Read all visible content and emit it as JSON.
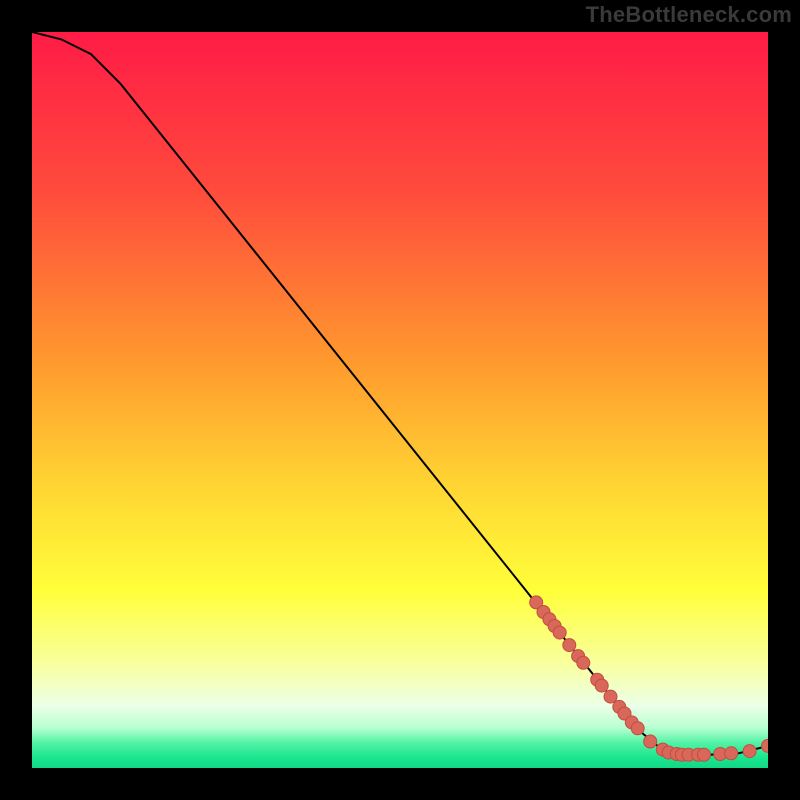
{
  "attribution": "TheBottleneck.com",
  "colors": {
    "frame": "#000000",
    "attribution_text": "#3a3a3a",
    "curve": "#000000",
    "marker_fill": "#d9675a",
    "marker_stroke": "#c24d40",
    "gradient_stops": [
      {
        "offset": 0.0,
        "color": "#ff1b46"
      },
      {
        "offset": 0.22,
        "color": "#ff4c3c"
      },
      {
        "offset": 0.45,
        "color": "#ff9a2e"
      },
      {
        "offset": 0.62,
        "color": "#ffd633"
      },
      {
        "offset": 0.76,
        "color": "#ffff3a"
      },
      {
        "offset": 0.86,
        "color": "#f8ffa0"
      },
      {
        "offset": 0.915,
        "color": "#ecffe8"
      },
      {
        "offset": 0.945,
        "color": "#b8ffd0"
      },
      {
        "offset": 0.965,
        "color": "#55f3a7"
      },
      {
        "offset": 0.985,
        "color": "#1de690"
      },
      {
        "offset": 1.0,
        "color": "#10d884"
      }
    ]
  },
  "chart_data": {
    "type": "line",
    "title": "",
    "xlabel": "",
    "ylabel": "",
    "xlim": [
      0,
      100
    ],
    "ylim": [
      0,
      100
    ],
    "series": [
      {
        "name": "bottleneck-curve",
        "x": [
          0,
          4,
          8,
          12,
          20,
          30,
          40,
          50,
          60,
          68,
          72,
          76,
          80,
          82,
          85,
          88,
          92,
          96,
          100
        ],
        "y": [
          100,
          99,
          97,
          93,
          83,
          70.5,
          58,
          45.5,
          33,
          23,
          18,
          13,
          8,
          5.5,
          3,
          2,
          1.8,
          2,
          3
        ]
      }
    ],
    "markers": {
      "name": "data-points",
      "points": [
        {
          "x": 68.5,
          "y": 22.5
        },
        {
          "x": 69.5,
          "y": 21.2
        },
        {
          "x": 70.3,
          "y": 20.2
        },
        {
          "x": 71.0,
          "y": 19.3
        },
        {
          "x": 71.7,
          "y": 18.4
        },
        {
          "x": 73.0,
          "y": 16.7
        },
        {
          "x": 74.2,
          "y": 15.2
        },
        {
          "x": 74.9,
          "y": 14.3
        },
        {
          "x": 76.8,
          "y": 12.0
        },
        {
          "x": 77.4,
          "y": 11.2
        },
        {
          "x": 78.6,
          "y": 9.7
        },
        {
          "x": 79.8,
          "y": 8.3
        },
        {
          "x": 80.5,
          "y": 7.4
        },
        {
          "x": 81.5,
          "y": 6.2
        },
        {
          "x": 82.3,
          "y": 5.4
        },
        {
          "x": 84.0,
          "y": 3.6
        },
        {
          "x": 85.7,
          "y": 2.5
        },
        {
          "x": 86.5,
          "y": 2.1
        },
        {
          "x": 87.6,
          "y": 1.9
        },
        {
          "x": 88.3,
          "y": 1.8
        },
        {
          "x": 89.2,
          "y": 1.8
        },
        {
          "x": 90.5,
          "y": 1.8
        },
        {
          "x": 91.3,
          "y": 1.8
        },
        {
          "x": 93.5,
          "y": 1.9
        },
        {
          "x": 95.0,
          "y": 2.0
        },
        {
          "x": 97.5,
          "y": 2.3
        },
        {
          "x": 100.0,
          "y": 3.0
        }
      ]
    }
  }
}
